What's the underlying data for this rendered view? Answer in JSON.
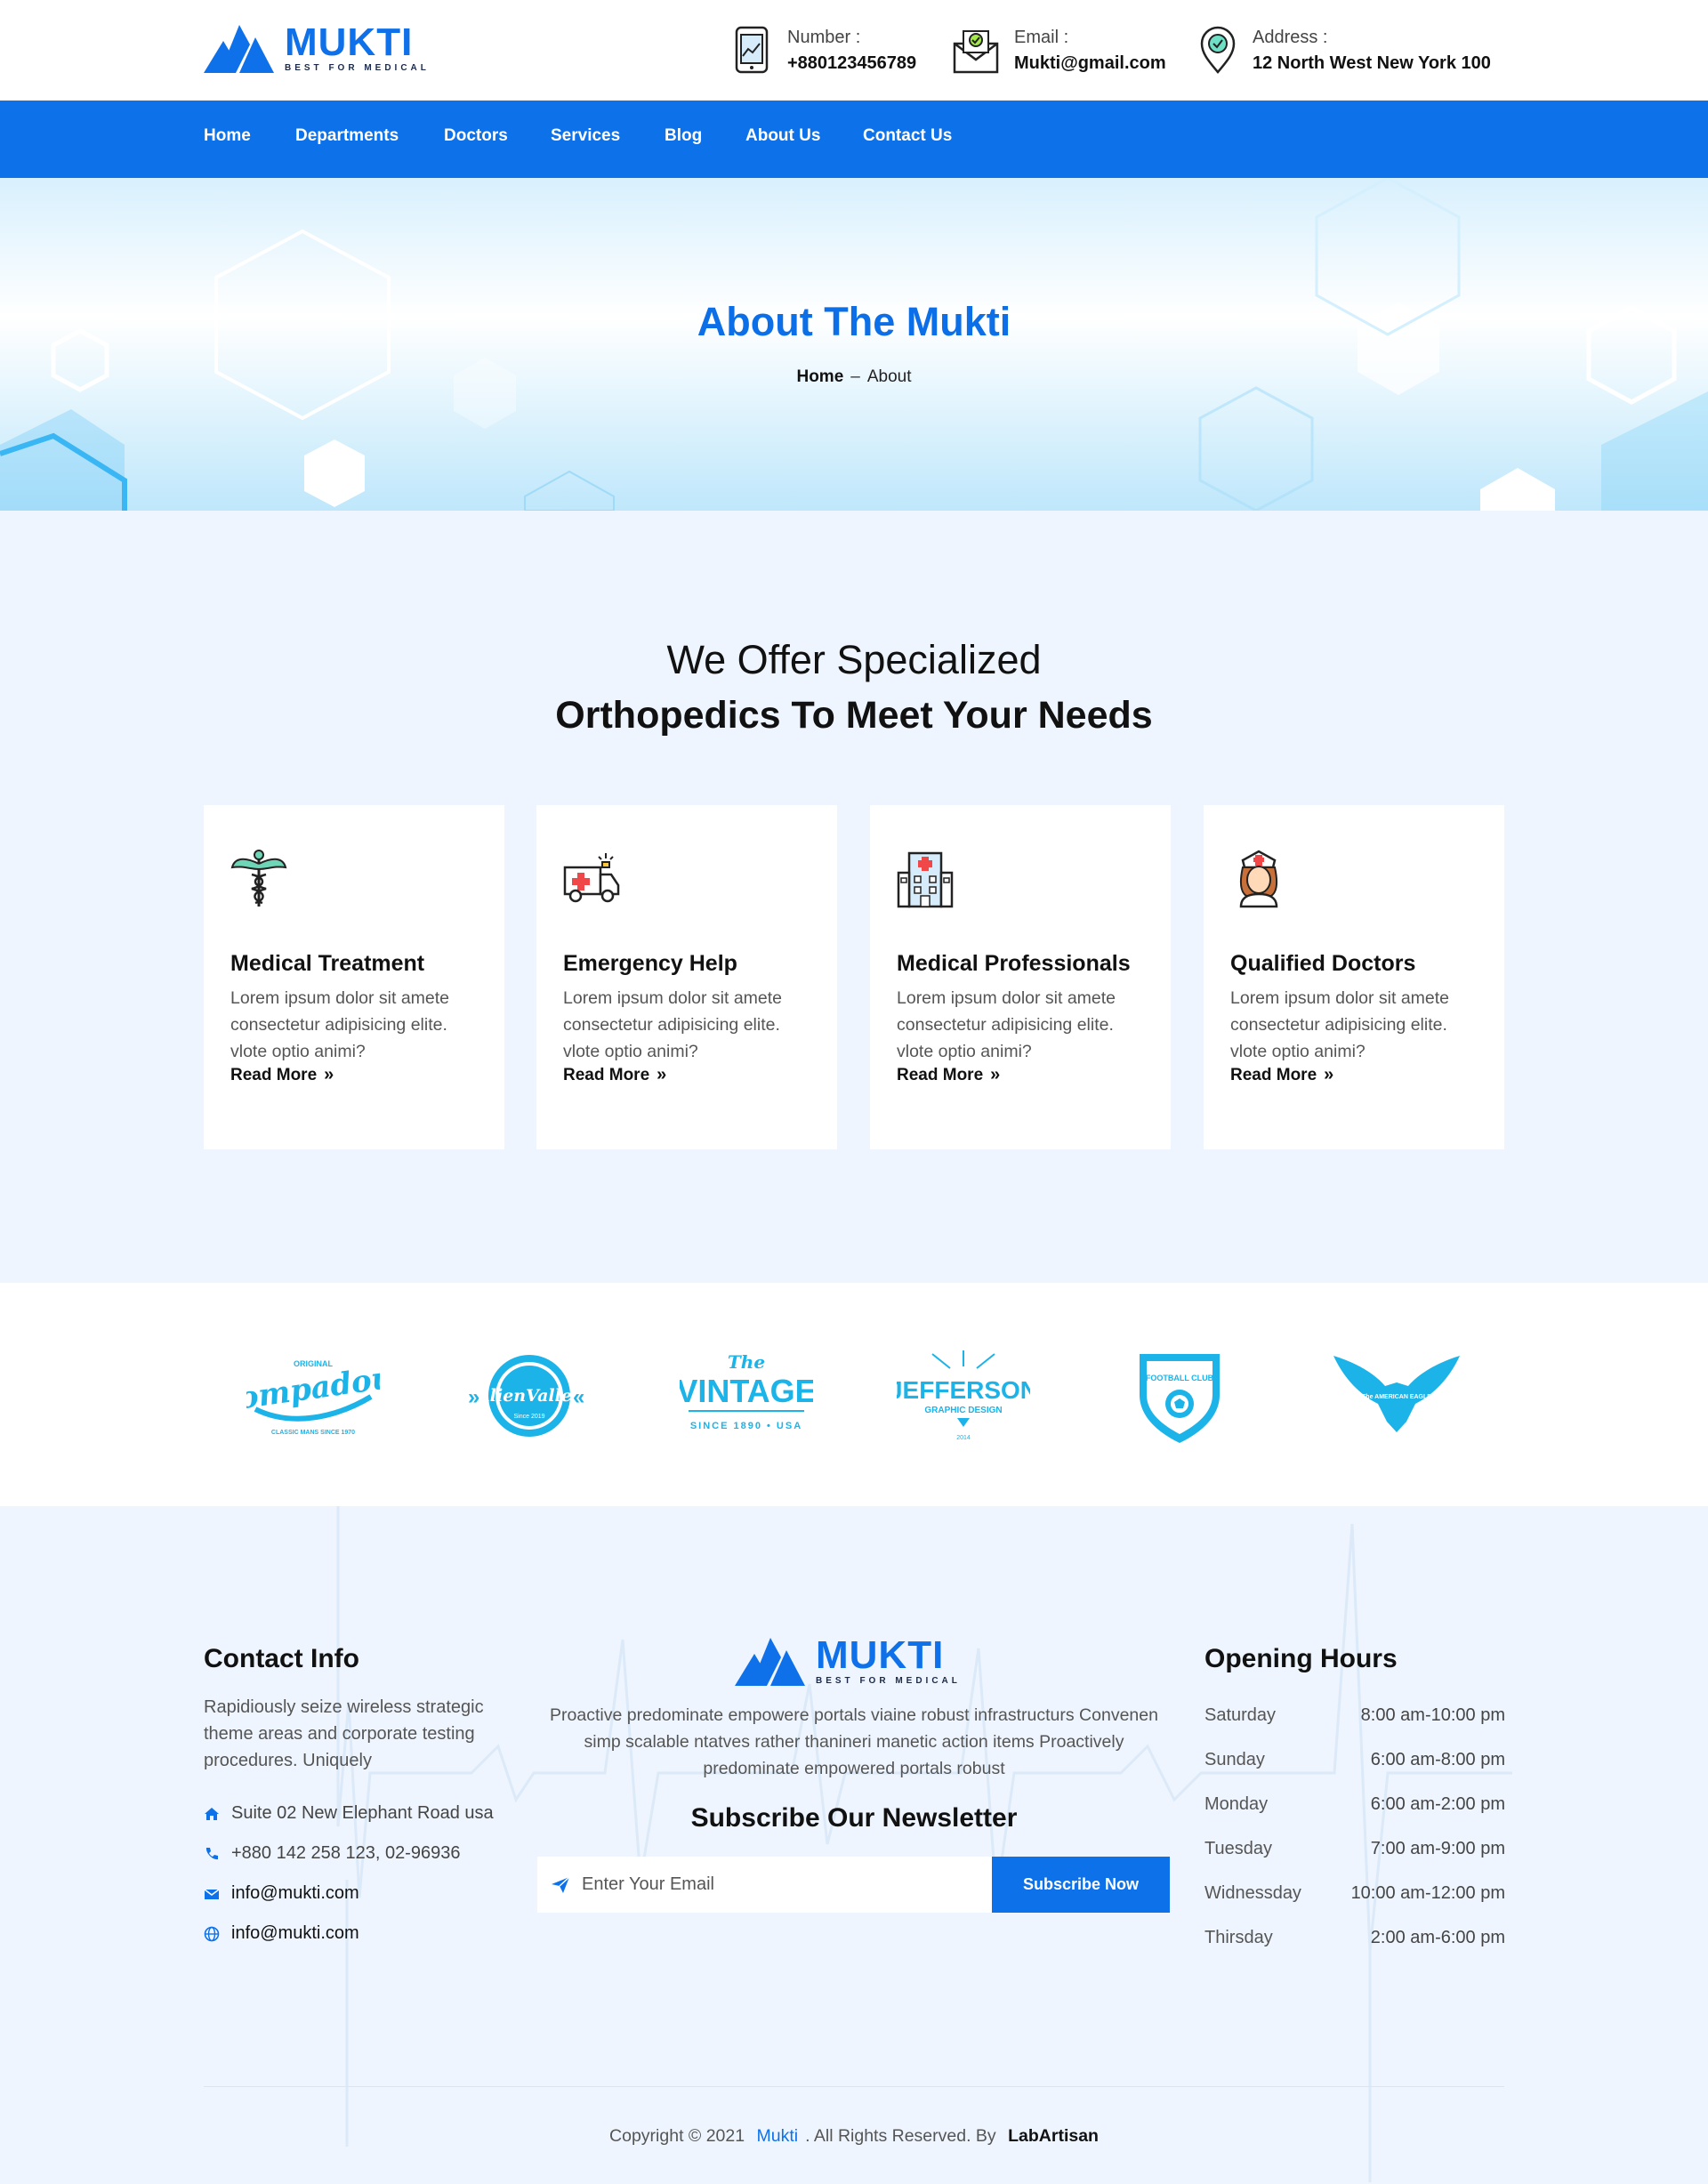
{
  "brand": {
    "name": "MUKTI",
    "tagline": "BEST FOR MEDICAL"
  },
  "header": {
    "contacts": [
      {
        "icon": "phone-icon",
        "label": "Number :",
        "value": "+880123456789"
      },
      {
        "icon": "mail-icon",
        "label": "Email :",
        "value": "Mukti@gmail.com"
      },
      {
        "icon": "location-pin-icon",
        "label": "Address :",
        "value": "12 North West New York 100"
      }
    ]
  },
  "nav": {
    "items": [
      "Home",
      "Departments",
      "Doctors",
      "Services",
      "Blog",
      "About Us",
      "Contact Us"
    ]
  },
  "hero": {
    "title": "About The Mukti",
    "breadcrumb_home": "Home",
    "breadcrumb_sep": "–",
    "breadcrumb_current": "About"
  },
  "services": {
    "subtitle": "We Offer Specialized",
    "title": "Orthopedics To Meet Your Needs",
    "cards": [
      {
        "icon": "caduceus-icon",
        "title": "Medical Treatment",
        "text": "Lorem ipsum dolor sit amete consectetur adipisicing elite. vlote optio animi?",
        "link": "Read More"
      },
      {
        "icon": "ambulance-icon",
        "title": "Emergency Help",
        "text": "Lorem ipsum dolor sit amete consectetur adipisicing elite. vlote optio animi?",
        "link": "Read More"
      },
      {
        "icon": "hospital-icon",
        "title": "Medical Professionals",
        "text": "Lorem ipsum dolor sit amete consectetur adipisicing elite. vlote optio animi?",
        "link": "Read More"
      },
      {
        "icon": "nurse-icon",
        "title": "Qualified Doctors",
        "text": "Lorem ipsum dolor sit amete consectetur adipisicing elite. vlote optio animi?",
        "link": "Read More"
      }
    ]
  },
  "brands": {
    "color": "#1cb3e8",
    "logos": [
      {
        "name": "pompadour-logo",
        "text": "Pompadour",
        "sub": "ORIGINAL",
        "bottom": "CLASSIC MANS SINCE 1970"
      },
      {
        "name": "alien-valley-logo",
        "text": "AlienValley",
        "sub": "Since 2019"
      },
      {
        "name": "vintage-logo",
        "text": "VINTAGE",
        "sub": "The",
        "bottom": "SINCE 1890 • USA"
      },
      {
        "name": "jefferson-logo",
        "text": "JEFFERSON",
        "sub": "GRAPHIC DESIGN",
        "bottom": "2014"
      },
      {
        "name": "football-club-logo",
        "text": "FOOTBALL CLUB"
      },
      {
        "name": "american-eagle-logo",
        "text": "The AMERICAN EAGLE"
      }
    ]
  },
  "footer": {
    "contact": {
      "title": "Contact Info",
      "text": "Rapidiously seize wireless strategic theme areas and corporate testing procedures. Uniquely",
      "lines": [
        {
          "icon": "home-icon",
          "text": "Suite 02 New Elephant Road usa"
        },
        {
          "icon": "phone-icon",
          "text": "+880 142 258 123, 02-96936"
        },
        {
          "icon": "mail-icon",
          "text": "info@mukti.com"
        },
        {
          "icon": "globe-icon",
          "text": "info@mukti.com"
        }
      ]
    },
    "about": "Proactive predominate empowere portals viaine robust infrastructurs Convenen simp scalable ntatves rather thanineri manetic action items Proactively predominate empowered portals robust",
    "newsletter": {
      "title": "Subscribe Our Newsletter",
      "placeholder": "Enter Your Email",
      "button": "Subscribe Now"
    },
    "hours": {
      "title": "Opening Hours",
      "rows": [
        {
          "day": "Saturday",
          "time": "8:00 am-10:00 pm"
        },
        {
          "day": "Sunday",
          "time": "6:00 am-8:00 pm"
        },
        {
          "day": "Monday",
          "time": "6:00 am-2:00 pm"
        },
        {
          "day": "Tuesday",
          "time": "7:00 am-9:00 pm"
        },
        {
          "day": "Widnessday",
          "time": "10:00 am-12:00 pm"
        },
        {
          "day": "Thirsday",
          "time": "2:00 am-6:00 pm"
        }
      ]
    },
    "copyright": {
      "prefix": "Copyright © 2021",
      "brand": "Mukti",
      "middle": ". All Rights Reserved. By",
      "author": "LabArtisan"
    }
  },
  "colors": {
    "primary": "#0d72ea",
    "background": "#eef5fe",
    "brand_logos": "#1cb3e8"
  }
}
